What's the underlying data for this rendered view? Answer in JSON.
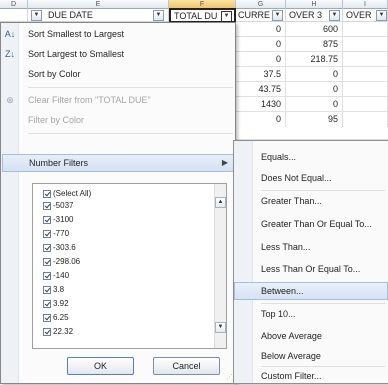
{
  "sheet": {
    "col_letters": [
      "D",
      "E",
      "F",
      "G",
      "H",
      "I"
    ],
    "headers": {
      "e": "DUE DATE",
      "f": "TOTAL DU",
      "g": "CURRE",
      "h": "OVER 3",
      "i": "OVER"
    },
    "rows": [
      {
        "g": "0",
        "h": "600"
      },
      {
        "g": "0",
        "h": "875"
      },
      {
        "g": "0",
        "h": "218.75"
      },
      {
        "g": "37.5",
        "h": "0"
      },
      {
        "g": "43.75",
        "h": "0"
      },
      {
        "g": "1430",
        "h": "0"
      },
      {
        "g": "0",
        "h": "95"
      }
    ]
  },
  "filter_menu": {
    "sort_smallest": "Sort Smallest to Largest",
    "sort_largest": "Sort Largest to Smallest",
    "sort_color": "Sort by Color",
    "clear_filter": "Clear Filter from \"TOTAL DUE\"",
    "filter_color": "Filter by Color",
    "number_filters": "Number Filters",
    "values": [
      "(Select All)",
      "-5037",
      "-3100",
      "-770",
      "-303.6",
      "-298.06",
      "-140",
      "3.8",
      "3.92",
      "6.25",
      "22.32"
    ],
    "ok_label": "OK",
    "cancel_label": "Cancel"
  },
  "submenu": {
    "items": [
      "Equals...",
      "Does Not Equal...",
      "Greater Than...",
      "Greater Than Or Equal To...",
      "Less Than...",
      "Less Than Or Equal To...",
      "Between...",
      "Top 10...",
      "Above Average",
      "Below Average",
      "Custom Filter..."
    ]
  },
  "icons": {
    "sort_asc": "sort-ascending-icon",
    "sort_desc": "sort-descending-icon",
    "clear_filter": "clear-filter-icon",
    "dropdown": "dropdown-arrow-icon",
    "submenu_arrow": "submenu-arrow-icon"
  },
  "colors": {
    "highlight": "#d6e3f4",
    "selected_header": "#f1c15f"
  }
}
